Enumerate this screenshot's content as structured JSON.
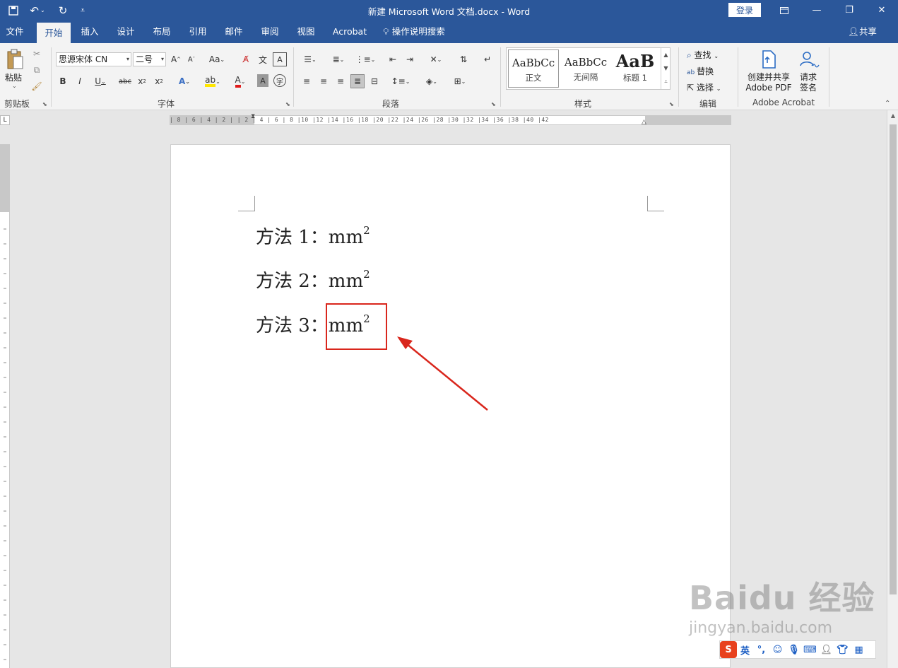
{
  "titlebar": {
    "title": "新建 Microsoft Word 文档.docx  -  Word",
    "login": "登录",
    "icons": [
      "save-icon",
      "undo-icon",
      "redo-icon",
      "customize-qat-icon"
    ]
  },
  "tabs": [
    "文件",
    "开始",
    "插入",
    "设计",
    "布局",
    "引用",
    "邮件",
    "审阅",
    "视图",
    "Acrobat"
  ],
  "active_tab": "开始",
  "tell_me": "操作说明搜索",
  "share": "共享",
  "ribbon": {
    "clipboard": {
      "paste": "粘贴",
      "label": "剪贴板"
    },
    "font": {
      "name": "思源宋体 CN",
      "size": "二号",
      "label": "字体"
    },
    "paragraph": {
      "label": "段落"
    },
    "styles": {
      "label": "样式",
      "items": [
        {
          "preview": "AaBbCc",
          "name": "正文"
        },
        {
          "preview": "AaBbCc",
          "name": "无间隔"
        },
        {
          "preview": "AaB",
          "name": "标题 1"
        }
      ]
    },
    "editing": {
      "find": "查找",
      "replace": "替换",
      "select": "选择",
      "label": "编辑"
    },
    "acrobat": {
      "create": "创建并共享",
      "create2": "Adobe PDF",
      "sign": "请求",
      "sign2": "签名",
      "label": "Adobe Acrobat"
    }
  },
  "ruler": {
    "ticks": "| 8 | 6 | 4 | 2 |   | 2 | 4 | 6 | 8 |10 |12 |14 |16 |18 |20 |22 |24 |26 |28 |30 |32 |34 |36 |38 |40 |42"
  },
  "document": {
    "lines": [
      {
        "text": "方法 1：mm",
        "sup": "2"
      },
      {
        "text": "方法 2：mm",
        "sup": "2"
      },
      {
        "text": "方法 3：mm",
        "sup": "2"
      }
    ]
  },
  "colors": {
    "accent": "#2b579a",
    "highlight_box": "#d9261c"
  },
  "watermark": {
    "brand": "Baidu 经验",
    "url": "jingyan.baidu.com"
  },
  "ime": {
    "mode": "英"
  }
}
